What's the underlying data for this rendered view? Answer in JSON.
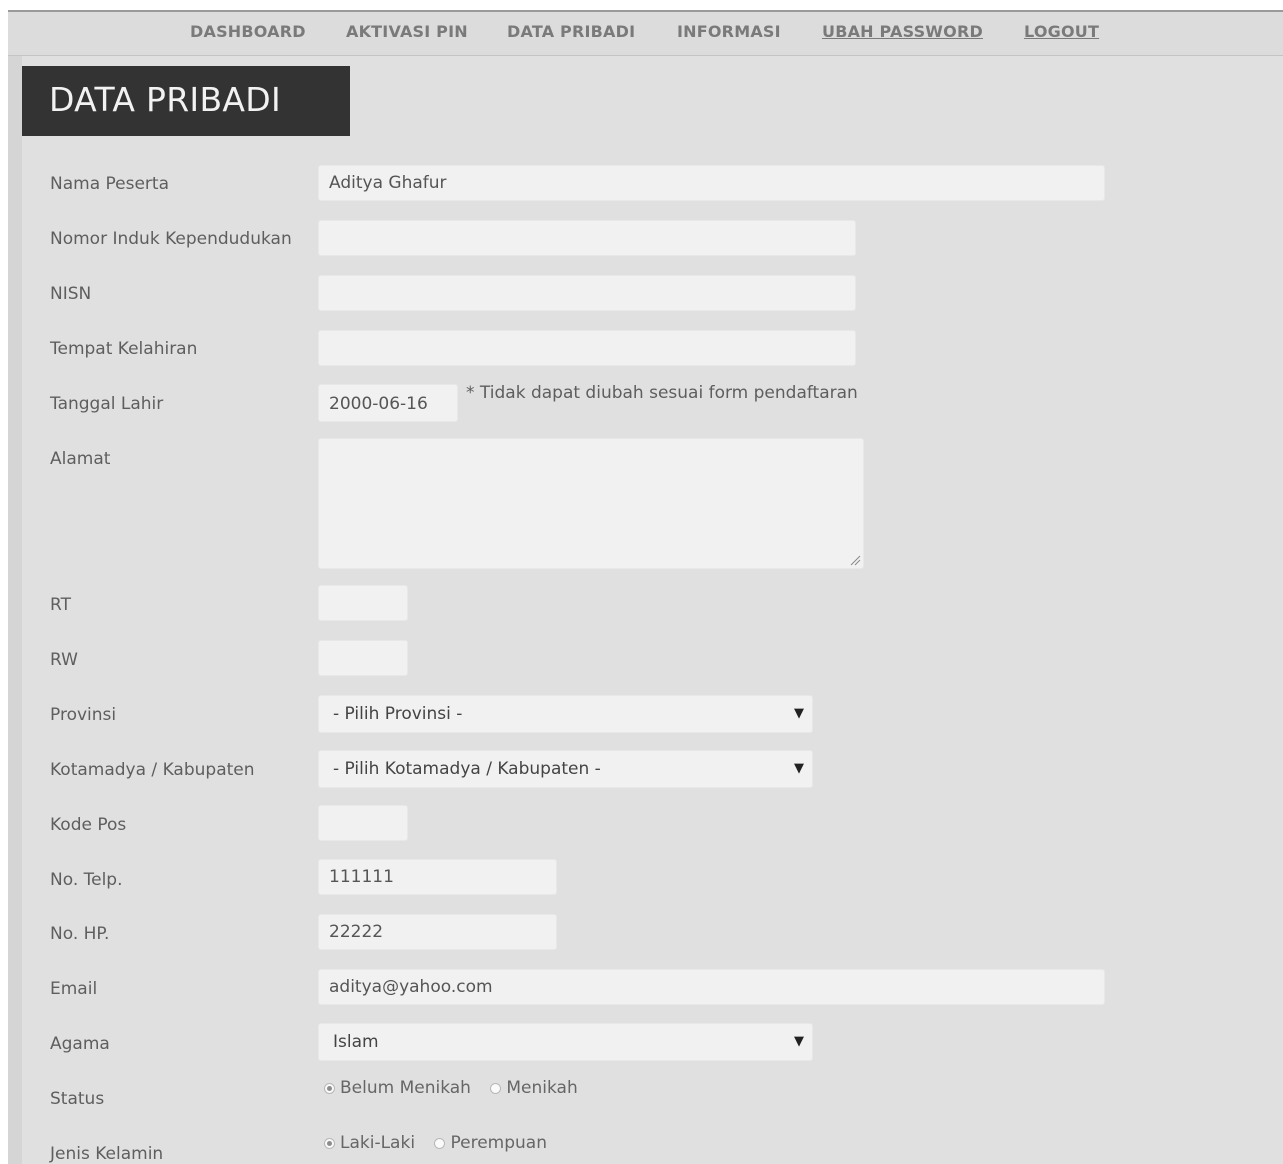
{
  "nav": {
    "items": [
      {
        "label": "DASHBOARD"
      },
      {
        "label": "AKTIVASI PIN"
      },
      {
        "label": "DATA PRIBADI"
      },
      {
        "label": "INFORMASI"
      },
      {
        "label": "UBAH PASSWORD"
      },
      {
        "label": "LOGOUT"
      }
    ]
  },
  "page": {
    "title": "DATA PRIBADI"
  },
  "form": {
    "nama_peserta": {
      "label": "Nama Peserta",
      "value": "Aditya Ghafur"
    },
    "nik": {
      "label": "Nomor Induk Kependudukan",
      "value": ""
    },
    "nisn": {
      "label": "NISN",
      "value": ""
    },
    "tempat_kelahiran": {
      "label": "Tempat Kelahiran",
      "value": ""
    },
    "tanggal_lahir": {
      "label": "Tanggal Lahir",
      "value": "2000-06-16",
      "note": "* Tidak dapat diubah sesuai form pendaftaran"
    },
    "alamat": {
      "label": "Alamat",
      "value": ""
    },
    "rt": {
      "label": "RT",
      "value": ""
    },
    "rw": {
      "label": "RW",
      "value": ""
    },
    "provinsi": {
      "label": "Provinsi",
      "selected": "- Pilih Provinsi -"
    },
    "kotamadya": {
      "label": "Kotamadya / Kabupaten",
      "selected": "- Pilih Kotamadya / Kabupaten -"
    },
    "kode_pos": {
      "label": "Kode Pos",
      "value": ""
    },
    "no_telp": {
      "label": "No. Telp.",
      "value": "111111"
    },
    "no_hp": {
      "label": "No. HP.",
      "value": "22222"
    },
    "email": {
      "label": "Email",
      "value": "aditya@yahoo.com"
    },
    "agama": {
      "label": "Agama",
      "selected": "Islam"
    },
    "status": {
      "label": "Status",
      "options": [
        "Belum Menikah",
        "Menikah"
      ],
      "selected": "Belum Menikah"
    },
    "jenis_kelamin": {
      "label": "Jenis Kelamin",
      "options": [
        "Laki-Laki",
        "Perempuan"
      ],
      "selected": "Laki-Laki"
    }
  },
  "icons": {
    "select_arrow": "triangle-down-icon"
  }
}
